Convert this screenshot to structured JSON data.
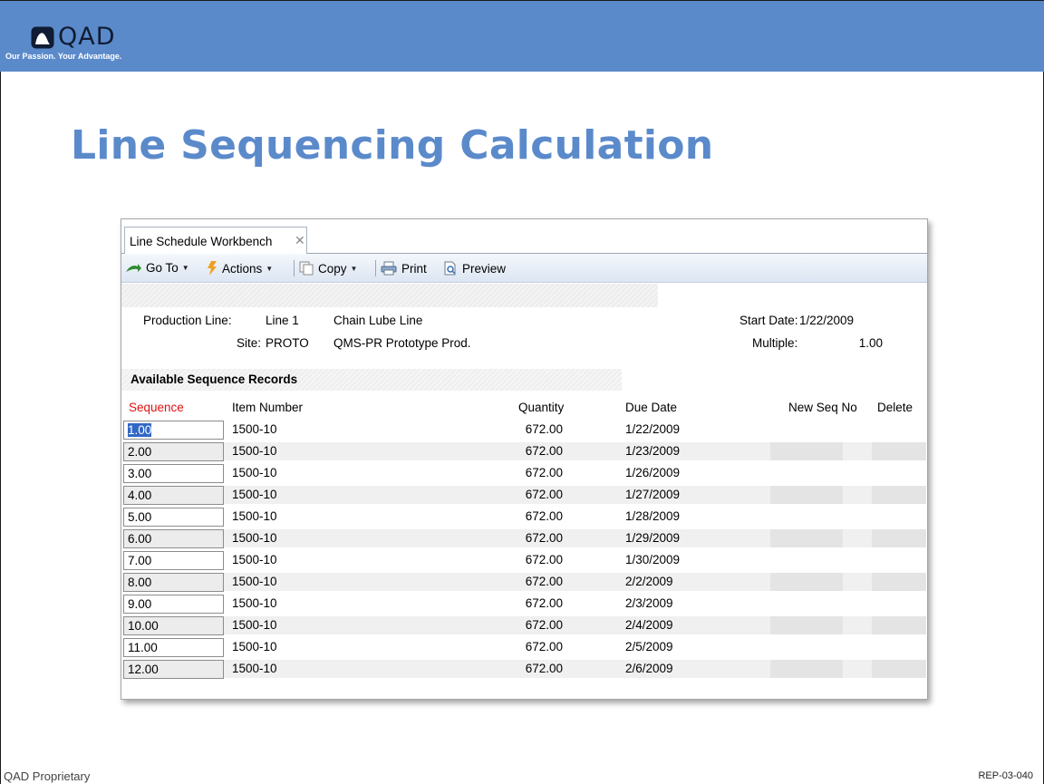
{
  "slide": {
    "logo_text": "QAD",
    "tagline": "Our Passion. Your Advantage.",
    "title": "Line Sequencing Calculation",
    "footer_left": "QAD Proprietary",
    "footer_right": "REP-03-040",
    "colors": {
      "band": "#5b8acb",
      "title": "#5b8acb"
    }
  },
  "window": {
    "tab_label": "Line Schedule Workbench",
    "tab_close_icon": "close-icon",
    "toolbar": {
      "goto_label": "Go To",
      "actions_label": "Actions",
      "copy_label": "Copy",
      "print_label": "Print",
      "preview_label": "Preview"
    },
    "header": {
      "production_line_label": "Production Line:",
      "production_line_value": "Line 1",
      "line_description": "Chain Lube Line",
      "site_label": "Site:",
      "site_value": "PROTO",
      "site_description": "QMS-PR Prototype Prod.",
      "start_date_label": "Start Date:",
      "start_date_value": "1/22/2009",
      "multiple_label": "Multiple:",
      "multiple_value": "1.00"
    },
    "section_title": "Available Sequence Records",
    "columns": {
      "sequence": "Sequence",
      "item_number": "Item Number",
      "quantity": "Quantity",
      "due_date": "Due Date",
      "new_seq_no": "New Seq No",
      "delete": "Delete"
    },
    "rows": [
      {
        "sequence": "1.00",
        "item": "1500-10",
        "quantity": "672.00",
        "due": "1/22/2009"
      },
      {
        "sequence": "2.00",
        "item": "1500-10",
        "quantity": "672.00",
        "due": "1/23/2009"
      },
      {
        "sequence": "3.00",
        "item": "1500-10",
        "quantity": "672.00",
        "due": "1/26/2009"
      },
      {
        "sequence": "4.00",
        "item": "1500-10",
        "quantity": "672.00",
        "due": "1/27/2009"
      },
      {
        "sequence": "5.00",
        "item": "1500-10",
        "quantity": "672.00",
        "due": "1/28/2009"
      },
      {
        "sequence": "6.00",
        "item": "1500-10",
        "quantity": "672.00",
        "due": "1/29/2009"
      },
      {
        "sequence": "7.00",
        "item": "1500-10",
        "quantity": "672.00",
        "due": "1/30/2009"
      },
      {
        "sequence": "8.00",
        "item": "1500-10",
        "quantity": "672.00",
        "due": "2/2/2009"
      },
      {
        "sequence": "9.00",
        "item": "1500-10",
        "quantity": "672.00",
        "due": "2/3/2009"
      },
      {
        "sequence": "10.00",
        "item": "1500-10",
        "quantity": "672.00",
        "due": "2/4/2009"
      },
      {
        "sequence": "11.00",
        "item": "1500-10",
        "quantity": "672.00",
        "due": "2/5/2009"
      },
      {
        "sequence": "12.00",
        "item": "1500-10",
        "quantity": "672.00",
        "due": "2/6/2009"
      }
    ]
  }
}
